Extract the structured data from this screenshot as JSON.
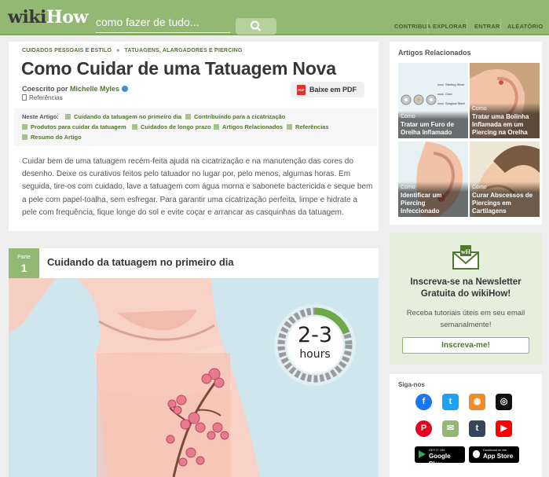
{
  "header": {
    "logo_wiki": "wiki",
    "logo_how": "How",
    "search_placeholder": "como fazer de tudo...",
    "nav": [
      "CONTRIBUA",
      "EXPLORAR",
      "ENTRAR",
      "ALEATÓRIO"
    ],
    "brand_color": "#93b874"
  },
  "article": {
    "breadcrumb": [
      "CUIDADOS PESSOAIS E ESTILO",
      "»",
      "TATUAGENS, ALARGADORES E PIERCING"
    ],
    "title": "Como Cuidar de uma Tatuagem Nova",
    "coauthor_label": "Coescrito por",
    "coauthor": "Michelle Myles",
    "references": "Referências",
    "pdf_label": "Baixe em PDF",
    "toc_label": "Neste Artigo:",
    "toc": [
      "Cuidando da tatuagem no primeiro dia",
      "Contribuindo para a cicatrização",
      "Produtos para cuidar da tatuagem",
      "Cuidados de longo prazo",
      "Artigos Relacionados",
      "Referências",
      "Resumo do Artigo"
    ],
    "intro": "Cuidar bem de uma tatuagem recém-feita ajuda na cicatrização e na manutenção das cores do desenho. Deixe os curativos feitos pelo tatuador no lugar por, pelo menos, algumas horas. Em seguida, tire-os com cuidado, lave a tatuagem com água morna e sabonete bactericida e seque bem a pele com papel-toalha, sem esfregar. Para garantir uma cicatrização perfeita, limpe e hidrate a pele com frequência, fique longe do sol e evite coçar e arrancar as casquinhas da tatuagem.",
    "part_label": "Parte",
    "part_number": "1",
    "part_title": "Cuidando da tatuagem no primeiro dia",
    "timer_value": "2-3",
    "timer_unit": "hours",
    "timer_progress": 0.2
  },
  "sidebar": {
    "related_title": "Artigos Relacionados",
    "related": [
      {
        "como": "Como",
        "title": "Tratar um Furo de Orelha Inflamado",
        "img_text": [
          "Sterling Silver",
          "Gold",
          "Surgical Steel"
        ]
      },
      {
        "como": "Como",
        "title": "Tratar uma Bolinha Inflamada em um Piercing na Orelha"
      },
      {
        "como": "Como",
        "title": "Identificar um Piercing Infeccionado"
      },
      {
        "como": "Como",
        "title": "Curar Abscessos de Piercings em Cartilagens"
      }
    ],
    "newsletter_title": "Inscreva-se na Newsletter Gratuita do wikiHow!",
    "newsletter_desc": "Receba tutoriais úteis em seu email semanalmente!",
    "newsletter_button": "Inscreva-me!",
    "follow_label": "Siga-nos",
    "social": [
      {
        "icon": "facebook-icon",
        "glyph": "f",
        "color": "#1877f2"
      },
      {
        "icon": "twitter-icon",
        "glyph": "t",
        "color": "#1da1f2"
      },
      {
        "icon": "rss-icon",
        "glyph": "◉",
        "color": "#f28c28"
      },
      {
        "icon": "instagram-icon",
        "glyph": "◎",
        "color": "#111111"
      },
      {
        "icon": "pinterest-icon",
        "glyph": "P",
        "color": "#e60023"
      },
      {
        "icon": "email-icon",
        "glyph": "✉",
        "color": "#93b874"
      },
      {
        "icon": "tumblr-icon",
        "glyph": "t",
        "color": "#35465c"
      },
      {
        "icon": "youtube-icon",
        "glyph": "▶",
        "color": "#ff0000"
      }
    ],
    "google_play_small": "GET IT ON",
    "google_play": "Google Play",
    "app_store_small": "Download on the",
    "app_store": "App Store"
  }
}
